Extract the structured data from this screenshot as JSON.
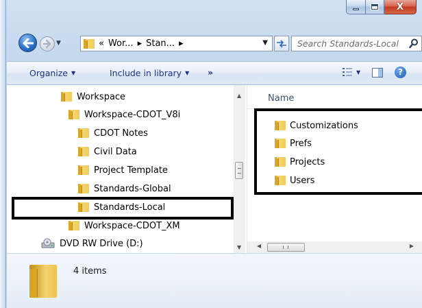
{
  "window": {
    "caption": {
      "close_glyph": "X"
    }
  },
  "nav": {
    "address_crumbs": [
      "«",
      "Wor...",
      "▸",
      "Stan...",
      "▸"
    ],
    "search_placeholder": "Search Standards-Local"
  },
  "toolbar": {
    "organize_label": "Organize",
    "include_label": "Include in library",
    "more_label": "»"
  },
  "tree": [
    {
      "label": "Workspace",
      "indent": 1
    },
    {
      "label": "Workspace-CDOT_V8i",
      "indent": 2
    },
    {
      "label": "CDOT Notes",
      "indent": 3
    },
    {
      "label": "Civil Data",
      "indent": 3
    },
    {
      "label": "Project Template",
      "indent": 3
    },
    {
      "label": "Standards-Global",
      "indent": 3
    },
    {
      "label": "Standards-Local",
      "indent": 3,
      "selected": true
    },
    {
      "label": "Workspace-CDOT_XM",
      "indent": 2
    },
    {
      "label": "DVD RW Drive (D:)",
      "indent": 0,
      "icon": "dvd-drive-icon"
    }
  ],
  "file_list": {
    "column_header": "Name",
    "items": [
      "Customizations",
      "Prefs",
      "Projects",
      "Users"
    ]
  },
  "scroll": {
    "h_thumb_glyph": "III"
  },
  "details": {
    "item_count": "4 items"
  },
  "colors": {
    "toolbar_text": "#1e3287",
    "highlight_border": "#000000"
  }
}
